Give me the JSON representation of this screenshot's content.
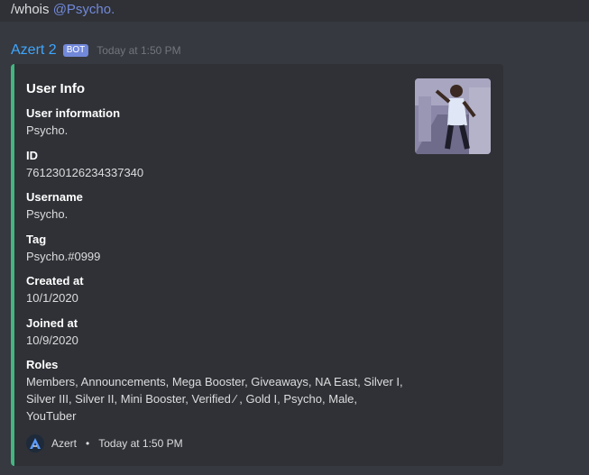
{
  "command": {
    "prefix": "/whois ",
    "mention": "@Psycho."
  },
  "message": {
    "author": "Azert 2",
    "bot_tag": "BOT",
    "timestamp": "Today at 1:50 PM"
  },
  "embed": {
    "accent_color": "#43b581",
    "title": "User Info",
    "fields": [
      {
        "name": "User information",
        "value": "Psycho."
      },
      {
        "name": "ID",
        "value": "761230126234337340"
      },
      {
        "name": "Username",
        "value": "Psycho."
      },
      {
        "name": "Tag",
        "value": "Psycho.#0999"
      },
      {
        "name": "Created at",
        "value": "10/1/2020"
      },
      {
        "name": "Joined at",
        "value": "10/9/2020"
      }
    ],
    "roles": {
      "name": "Roles",
      "value": "Members, Announcements, Mega Booster, Giveaways, NA East, Silver I, Silver III, Silver II, Mini Booster, Verified ⁄ , Gold I, Psycho, Male, YouTuber"
    },
    "footer": {
      "icon": "azert-logo-icon",
      "text": "Azert",
      "separator": "•",
      "timestamp": "Today at 1:50 PM"
    }
  }
}
